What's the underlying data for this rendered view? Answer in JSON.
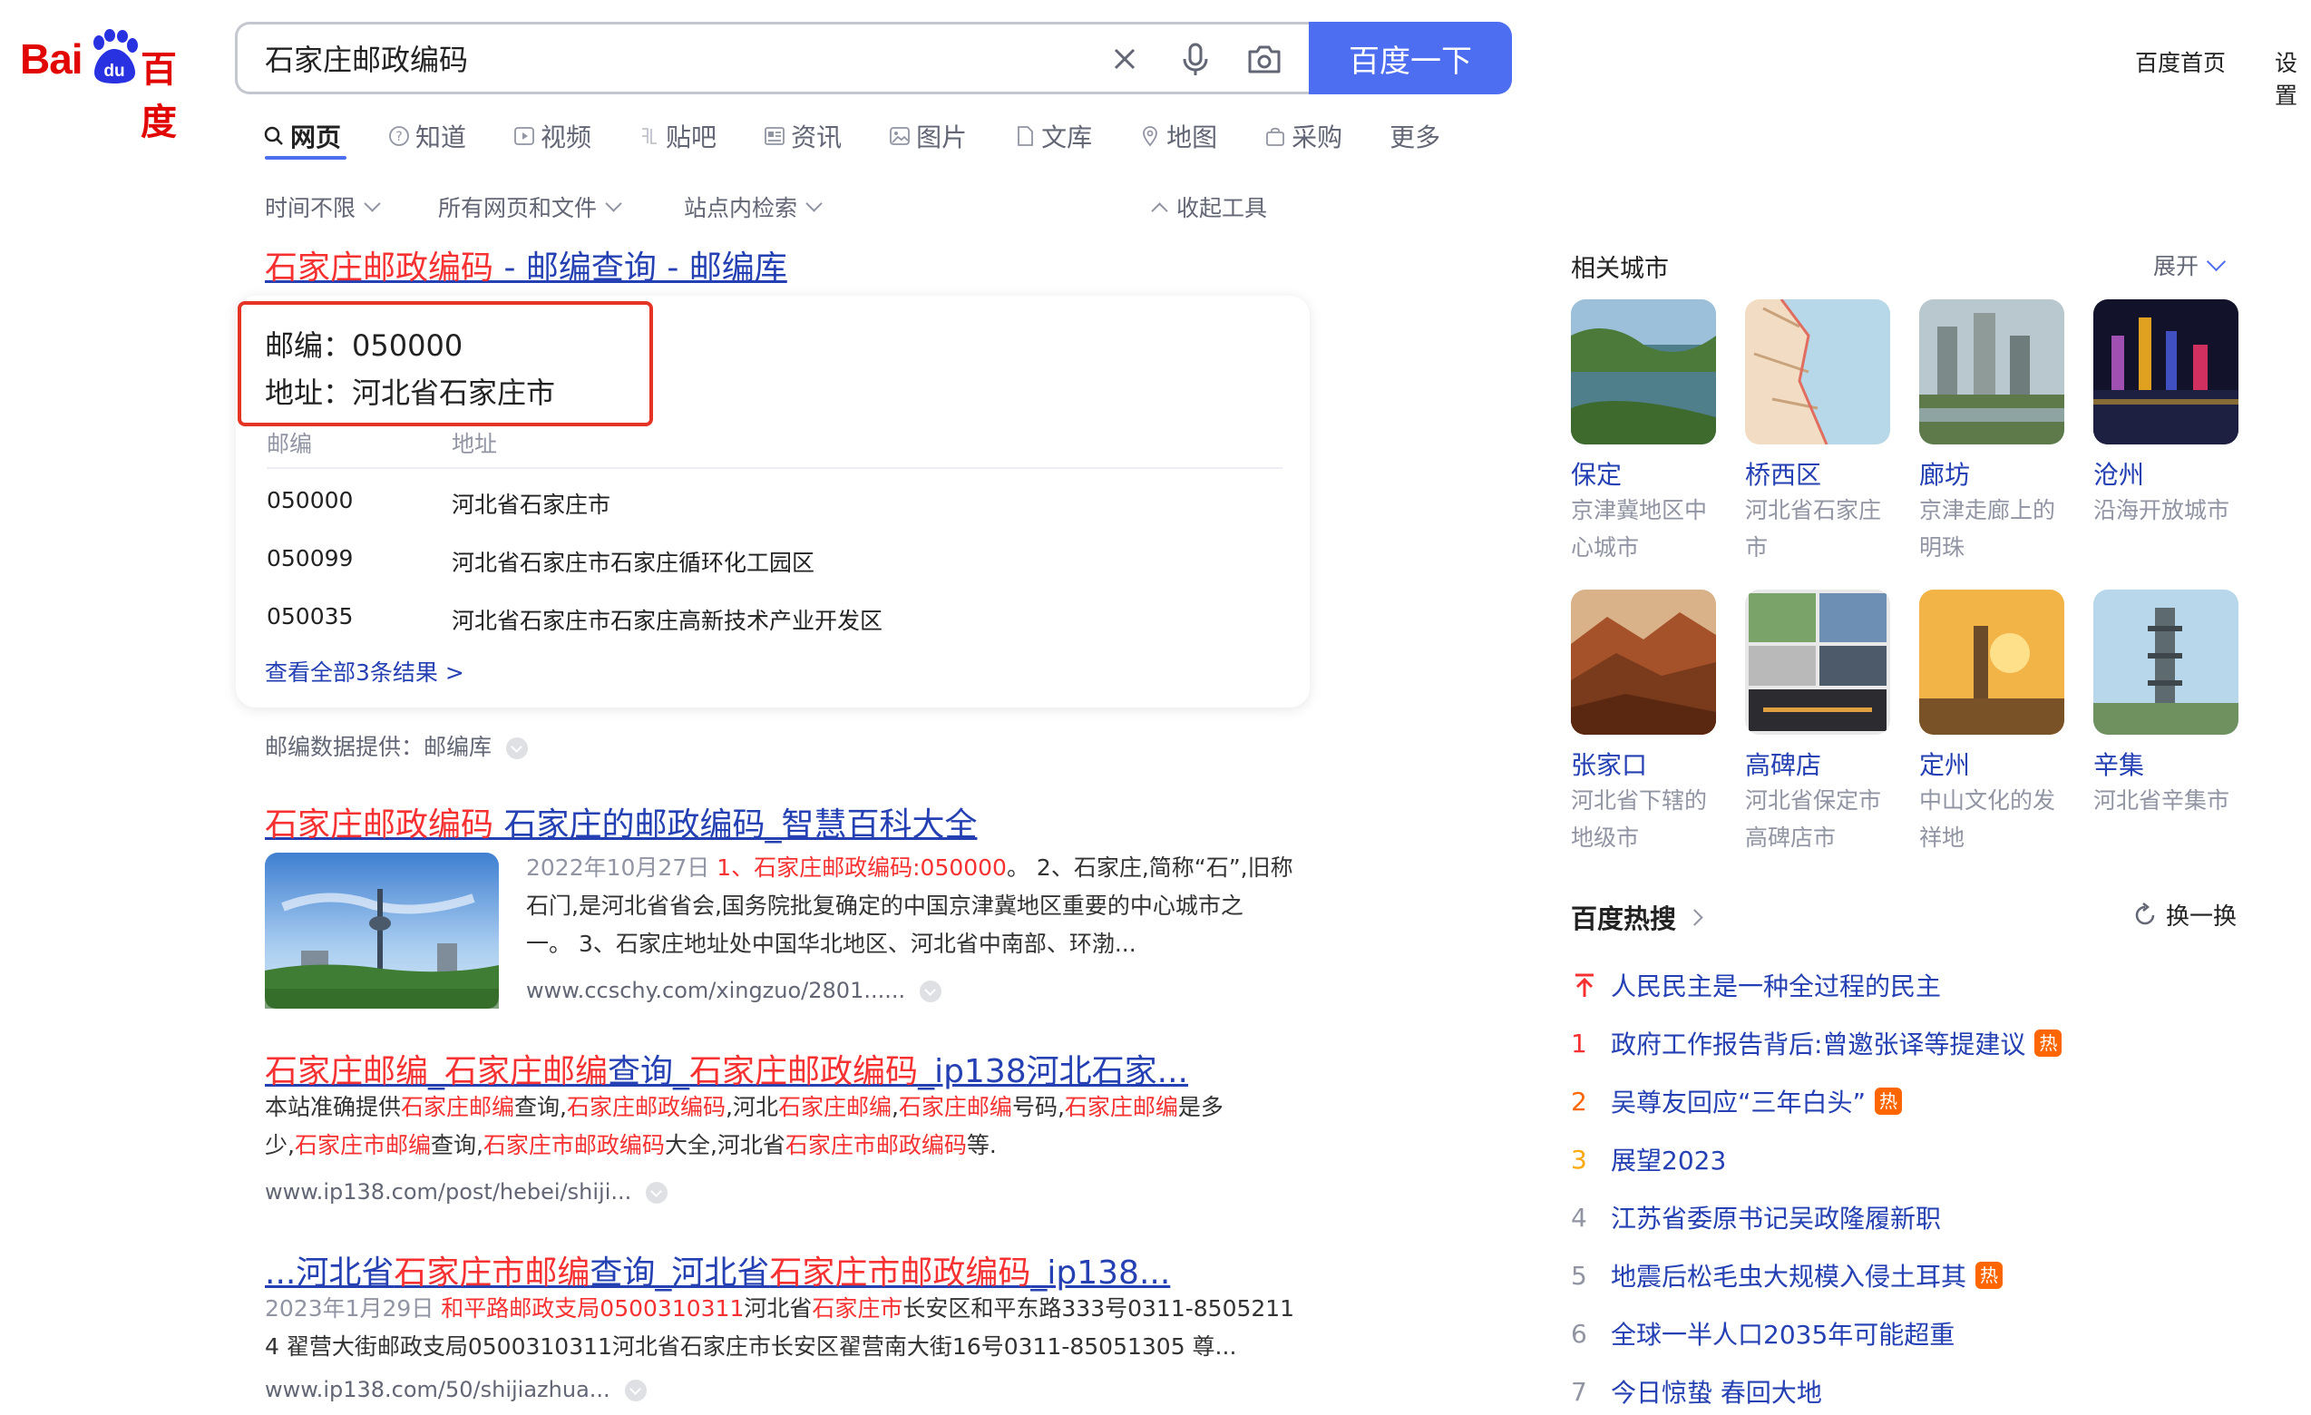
{
  "logo": {
    "text_bai": "Bai",
    "text_du": "du",
    "text_cn": "百度"
  },
  "search": {
    "query": "石家庄邮政编码",
    "button": "百度一下"
  },
  "topnav": {
    "home": "百度首页",
    "settings": "设置"
  },
  "tabs": [
    {
      "label": "网页",
      "icon": "search-icon"
    },
    {
      "label": "知道",
      "icon": "question-icon"
    },
    {
      "label": "视频",
      "icon": "video-icon"
    },
    {
      "label": "贴吧",
      "icon": "tieba-icon"
    },
    {
      "label": "资讯",
      "icon": "news-icon"
    },
    {
      "label": "图片",
      "icon": "image-icon"
    },
    {
      "label": "文库",
      "icon": "doc-icon"
    },
    {
      "label": "地图",
      "icon": "map-icon"
    },
    {
      "label": "采购",
      "icon": "bag-icon"
    },
    {
      "label": "更多",
      "icon": ""
    }
  ],
  "filters": {
    "time": "时间不限",
    "filetype": "所有网页和文件",
    "site": "站点内检索",
    "collapse": "收起工具"
  },
  "result1": {
    "title_hl": "石家庄邮政编码",
    "title_rest": " - 邮编查询 - 邮编库",
    "postcode_label": "邮编：",
    "postcode_value": "050000",
    "address_label": "地址：",
    "address_value": "河北省石家庄市",
    "table_headers": [
      "邮编",
      "地址"
    ],
    "rows": [
      {
        "code": "050000",
        "addr": "河北省石家庄市"
      },
      {
        "code": "050099",
        "addr": "河北省石家庄市石家庄循环化工园区"
      },
      {
        "code": "050035",
        "addr": "河北省石家庄市石家庄高新技术产业开发区"
      }
    ],
    "more": "查看全部3条结果 >",
    "source": "邮编数据提供：邮编库"
  },
  "result2": {
    "title_hl": "石家庄邮政编码",
    "title_rest": " 石家庄的邮政编码_智慧百科大全",
    "date": "2022年10月27日",
    "hl": "1、石家庄邮政编码:050000",
    "line1_rest": "。 2、石家庄,简称“石”,旧称",
    "line2": "石门,是河北省省会,国务院批复确定的中国京津冀地区重要的中心城市之",
    "line3": "一。 3、石家庄地址处中国华北地区、河北省中南部、环渤...",
    "url": "www.ccschy.com/xingzuo/2801......"
  },
  "result3": {
    "t1": "石家庄邮编",
    "t2": "_",
    "t3": "石家庄邮编",
    "t4": "查询_",
    "t5": "石家庄邮政编码",
    "t6": "_ip138",
    "t7": "河北石家...",
    "s1": "本站准确提供",
    "s2": "石家庄邮编",
    "s3": "查询,",
    "s4": "石家庄邮政编码",
    "s5": ",河北",
    "s6": "石家庄邮编",
    "s7": ",",
    "s8": "石家庄邮编",
    "s9": "号码,",
    "s10": "石家庄邮编",
    "s11": "是多",
    "s12": "少,",
    "s13": "石家庄市邮编",
    "s14": "查询,",
    "s15": "石家庄市邮政编码",
    "s16": "大全,河北省",
    "s17": "石家庄市邮政编码",
    "s18": "等.",
    "url": "www.ip138.com/post/hebei/shiji..."
  },
  "result4": {
    "t1": "...河北省",
    "t2": "石家庄市邮编",
    "t3": "查询_河北省",
    "t4": "石家庄市邮政编码",
    "t5": "_ip138...",
    "date": "2023年1月29日",
    "hl": "和平路邮政支局0500310311",
    "s2": "河北省",
    "s3": "石家庄市",
    "s4": "长安区和平东路333号0311-8505211",
    "line2": "4 翟营大街邮政支局0500310311河北省石家庄市长安区翟营南大街16号0311-85051305 尊...",
    "url": "www.ip138.com/50/shijiazhua..."
  },
  "side": {
    "cities_title": "相关城市",
    "expand": "展开",
    "cities": [
      {
        "name": "保定",
        "desc": "京津冀地区中心城市"
      },
      {
        "name": "桥西区",
        "desc": "河北省石家庄市"
      },
      {
        "name": "廊坊",
        "desc": "京津走廊上的明珠"
      },
      {
        "name": "沧州",
        "desc": "沿海开放城市"
      },
      {
        "name": "张家口",
        "desc": "河北省下辖的地级市"
      },
      {
        "name": "高碑店",
        "desc": "河北省保定市高碑店市"
      },
      {
        "name": "定州",
        "desc": "中山文化的发祥地"
      },
      {
        "name": "辛集",
        "desc": "河北省辛集市"
      }
    ],
    "hot_title": "百度热搜",
    "refresh": "换一换",
    "hot": [
      {
        "num": "",
        "text": "人民民主是一种全过程的民主",
        "badge": ""
      },
      {
        "num": "1",
        "text": "政府工作报告背后:曾邀张译等提建议",
        "badge": "热"
      },
      {
        "num": "2",
        "text": "吴尊友回应“三年白头”",
        "badge": "热"
      },
      {
        "num": "3",
        "text": "展望2023",
        "badge": ""
      },
      {
        "num": "4",
        "text": "江苏省委原书记吴政隆履新职",
        "badge": ""
      },
      {
        "num": "5",
        "text": "地震后松毛虫大规模入侵土耳其",
        "badge": "热"
      },
      {
        "num": "6",
        "text": "全球一半人口2035年可能超重",
        "badge": ""
      },
      {
        "num": "7",
        "text": "今日惊蛰 春回大地",
        "badge": ""
      }
    ]
  },
  "colors": {
    "accent": "#4e6ef2",
    "link": "#2440b3",
    "highlight": "#f73131",
    "hot_badge": "#ff6600"
  }
}
